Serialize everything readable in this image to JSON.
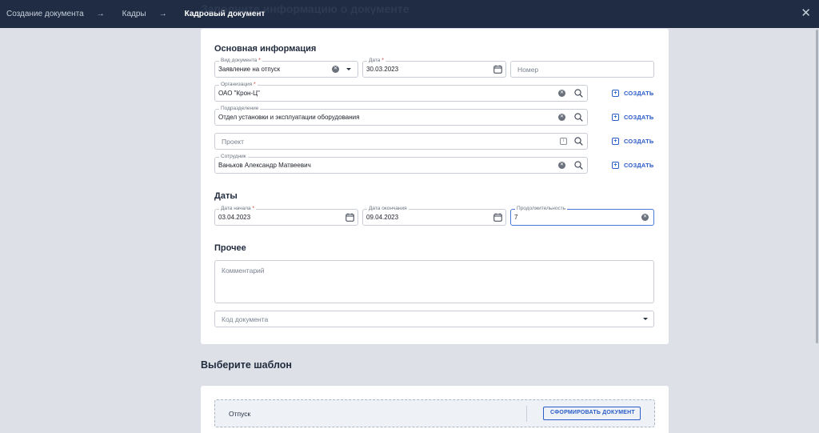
{
  "window": {
    "behind_title": "Заполните информацию о документе",
    "breadcrumbs": [
      "Создание документа",
      "Кадры",
      "Кадровый документ"
    ]
  },
  "sections": {
    "basic": "Основная информация",
    "dates": "Даты",
    "other": "Прочее"
  },
  "fields": {
    "doc_type": {
      "label": "Вид документа",
      "value": "Заявление на отпуск"
    },
    "date": {
      "label": "Дата",
      "value": "30.03.2023"
    },
    "number": {
      "placeholder": "Номер"
    },
    "organization": {
      "label": "Организация",
      "value": "ОАО \"Крон-Ц\""
    },
    "department": {
      "label": "Подразделение",
      "value": "Отдел установки и эксплуатации оборудования"
    },
    "project": {
      "placeholder": "Проект"
    },
    "employee": {
      "label": "Сотрудник",
      "value": "Ваньков Александр Матвеевич"
    },
    "start_date": {
      "label": "Дата начала",
      "value": "03.04.2023"
    },
    "end_date": {
      "label": "Дата окончания",
      "value": "09.04.2023"
    },
    "duration": {
      "label": "Продолжительность",
      "value": "7"
    },
    "comment": {
      "placeholder": "Комментарий"
    },
    "doc_code": {
      "placeholder": "Код документа"
    }
  },
  "actions": {
    "create_label": "СОЗДАТЬ"
  },
  "templates": {
    "title": "Выберите шаблон",
    "items": [
      {
        "name": "Отпуск",
        "button": "СФОРМИРОВАТЬ ДОКУМЕНТ"
      }
    ]
  },
  "icons": {
    "close": "close-icon",
    "clear": "clear-icon",
    "search": "search-icon",
    "calendar": "calendar-icon",
    "dropdown": "chevron-down-icon",
    "info": "info-icon",
    "add": "plus-square-icon"
  },
  "colors": {
    "topbar": "#1f2c43",
    "accent": "#2b5cc8",
    "required": "#d93025",
    "focus": "#4a78d6"
  }
}
